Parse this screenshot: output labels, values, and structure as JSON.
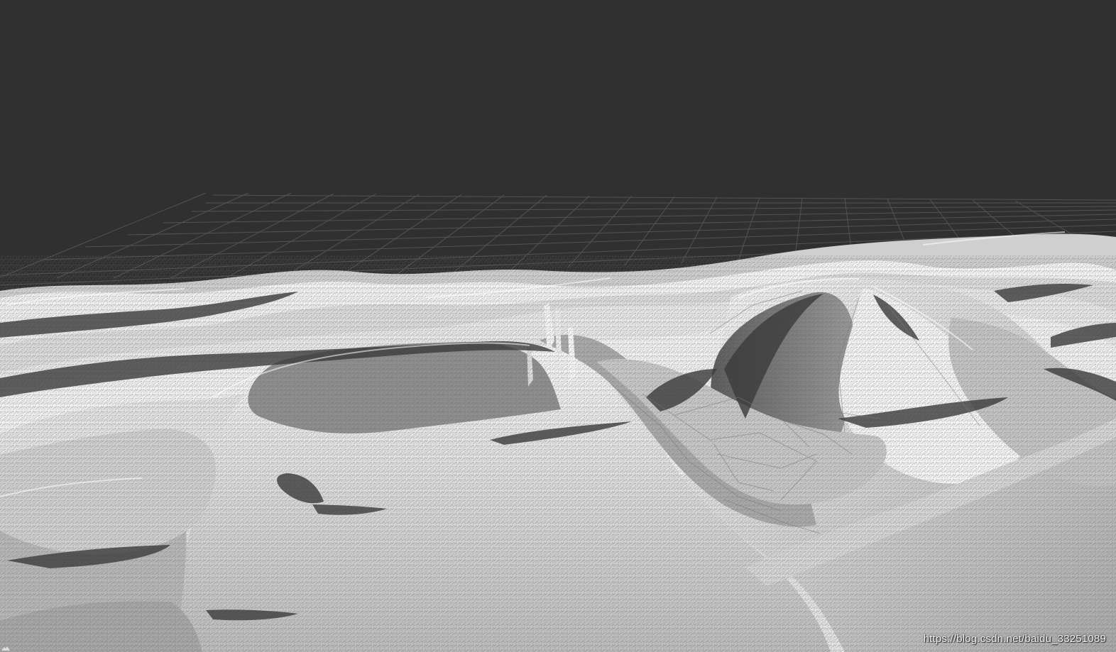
{
  "viewport": {
    "background_color": "#303030",
    "grid_color": "#5a5a5a",
    "terrain_color": "#e9e9e9",
    "shadow_color": "#3a3a3a"
  },
  "watermark": {
    "text": "https://blog.csdn.net/baidu_33251089"
  }
}
